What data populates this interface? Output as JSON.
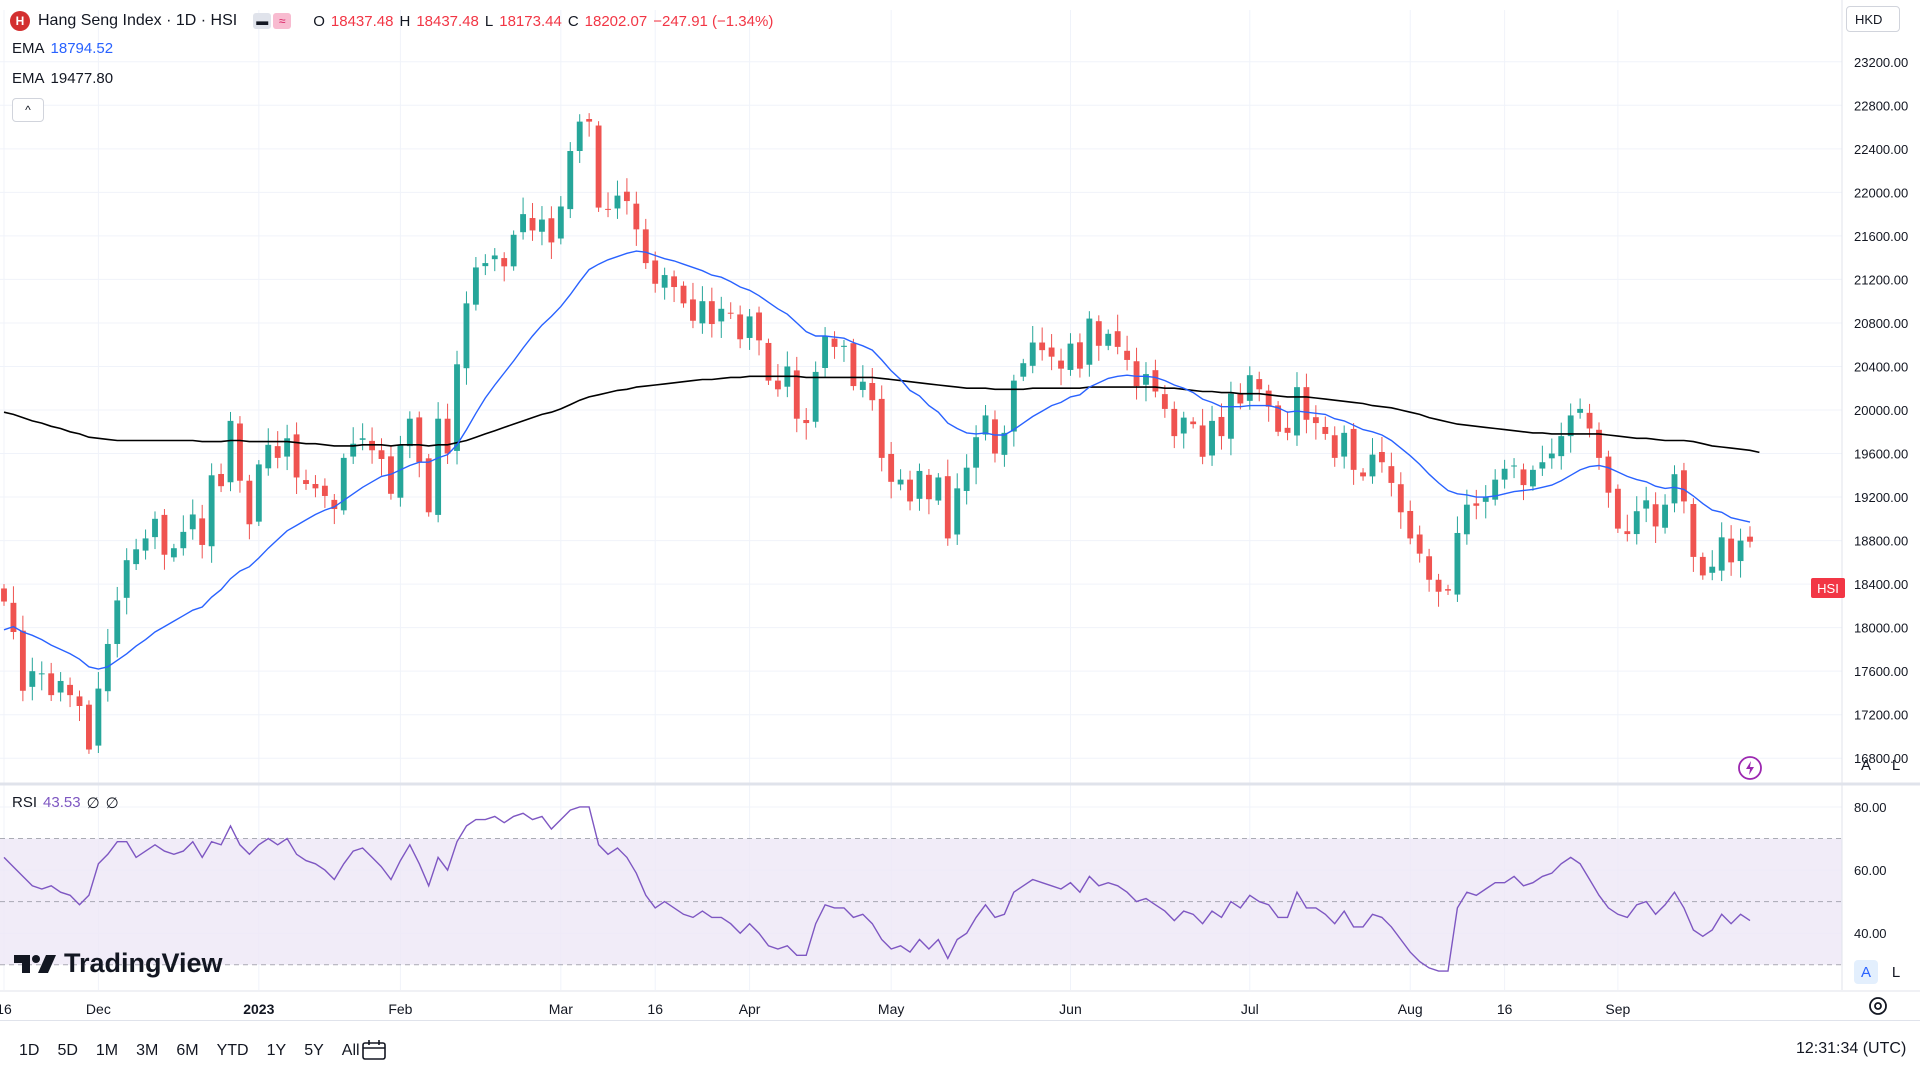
{
  "header": {
    "symbol_title": "Hang Seng Index · 1D · HSI",
    "logo_letter": "H",
    "compare_label": "≈",
    "o_label": "O",
    "o_value": "18437.48",
    "h_label": "H",
    "h_value": "18437.48",
    "l_label": "L",
    "l_value": "18173.44",
    "c_label": "C",
    "c_value": "18202.07",
    "change": "−247.91 (−1.34%)"
  },
  "indicators": {
    "ema1_label": "EMA",
    "ema1_value": "18794.52",
    "ema1_color": "#2962ff",
    "ema2_label": "EMA",
    "ema2_value": "19477.80",
    "ema2_color": "#000000",
    "collapse_icon": "^"
  },
  "currency": "HKD",
  "price_tag": "HSI",
  "rsi": {
    "label": "RSI",
    "value": "43.53",
    "extra1": "∅",
    "extra2": "∅",
    "color": "#7e57c2"
  },
  "buttons": {
    "auto": "A",
    "log": "L"
  },
  "brand": "TradingView",
  "timeframes": [
    "1D",
    "5D",
    "1M",
    "3M",
    "6M",
    "YTD",
    "1Y",
    "5Y",
    "All"
  ],
  "clock": "12:31:34 (UTC)",
  "colors": {
    "up": "#26a69a",
    "down": "#ef5350",
    "ema_fast": "#2962ff",
    "ema_slow": "#000000",
    "rsi": "#7e57c2",
    "rsi_band": "#ede7f6"
  },
  "chart_data": [
    {
      "type": "candlestick",
      "title": "Hang Seng Index · 1D · HSI",
      "y_ticks": [
        16800,
        17200,
        17600,
        18000,
        18400,
        18800,
        19200,
        19600,
        20000,
        20400,
        20800,
        21200,
        21600,
        22000,
        22400,
        22800,
        23200
      ],
      "y_tick_labels": [
        "16800.00",
        "17200.00",
        "17600.00",
        "18000.00",
        "18400.00",
        "18800.00",
        "19200.00",
        "19600.00",
        "20000.00",
        "20400.00",
        "20800.00",
        "21200.00",
        "21600.00",
        "22000.00",
        "22400.00",
        "22800.00",
        "23200.00"
      ],
      "x_tick_labels": [
        "16",
        "Dec",
        "2023",
        "Feb",
        "Mar",
        "16",
        "Apr",
        "May",
        "Jun",
        "Jul",
        "Aug",
        "16",
        "Sep"
      ],
      "x_tick_label_bars": [
        0,
        10,
        27,
        42,
        59,
        69,
        79,
        94,
        113,
        132,
        149,
        159,
        171
      ],
      "closes": [
        18240,
        17960,
        17420,
        17600,
        17580,
        17380,
        17510,
        17380,
        17280,
        16880,
        17440,
        17850,
        18250,
        18620,
        18720,
        18820,
        19000,
        18670,
        18730,
        18880,
        19040,
        18760,
        19400,
        19300,
        19900,
        19350,
        18950,
        19500,
        19680,
        19560,
        19740,
        19380,
        19320,
        19280,
        19210,
        19090,
        19560,
        19690,
        19740,
        19630,
        19550,
        19230,
        19680,
        19920,
        19520,
        19060,
        19920,
        19600,
        20420,
        20980,
        21310,
        21350,
        21420,
        21320,
        21610,
        21800,
        21650,
        21750,
        21540,
        21870,
        22380,
        22650,
        22650,
        21860,
        21840,
        21970,
        21920,
        21660,
        21350,
        21160,
        21240,
        21130,
        20980,
        20820,
        21000,
        20790,
        20930,
        20890,
        20650,
        20860,
        20640,
        20270,
        20190,
        20400,
        19920,
        19880,
        20350,
        20680,
        20580,
        20590,
        20220,
        20260,
        20090,
        19560,
        19340,
        19360,
        19160,
        19440,
        19180,
        19380,
        18820,
        19280,
        19470,
        19750,
        19950,
        19600,
        19790,
        20270,
        20430,
        20620,
        20550,
        20490,
        20380,
        20610,
        20380,
        20840,
        20590,
        20700,
        20580,
        20460,
        20220,
        20330,
        20170,
        20010,
        19760,
        19930,
        19870,
        19570,
        19900,
        19760,
        20150,
        20060,
        20320,
        20190,
        20030,
        19800,
        19790,
        20210,
        19910,
        19880,
        19780,
        19560,
        19790,
        19450,
        19390,
        19590,
        19520,
        19330,
        19060,
        18820,
        18680,
        18440,
        18330,
        18340,
        18870,
        19130,
        19120,
        19200,
        19360,
        19460,
        19490,
        19310,
        19450,
        19520,
        19600,
        19760,
        19950,
        20010,
        19830,
        19560,
        19240,
        18910,
        18860,
        19070,
        19170,
        18930,
        19130,
        19410,
        19160,
        18650,
        18480,
        18560,
        18830,
        18600,
        18800,
        18790
      ],
      "ema_fast": [
        17980,
        18010,
        17960,
        17930,
        17890,
        17840,
        17800,
        17760,
        17710,
        17640,
        17620,
        17640,
        17700,
        17760,
        17830,
        17890,
        17960,
        18010,
        18060,
        18110,
        18160,
        18190,
        18280,
        18350,
        18450,
        18520,
        18560,
        18640,
        18730,
        18810,
        18890,
        18940,
        18990,
        19040,
        19080,
        19110,
        19170,
        19230,
        19290,
        19340,
        19390,
        19410,
        19450,
        19490,
        19520,
        19520,
        19560,
        19590,
        19680,
        19820,
        19970,
        20110,
        20230,
        20340,
        20450,
        20570,
        20680,
        20780,
        20860,
        20950,
        21060,
        21180,
        21290,
        21340,
        21380,
        21410,
        21440,
        21460,
        21450,
        21420,
        21390,
        21370,
        21340,
        21310,
        21280,
        21240,
        21220,
        21180,
        21130,
        21100,
        21050,
        20990,
        20930,
        20880,
        20800,
        20720,
        20680,
        20680,
        20670,
        20660,
        20620,
        20590,
        20550,
        20460,
        20360,
        20280,
        20180,
        20130,
        20040,
        19980,
        19880,
        19830,
        19790,
        19780,
        19790,
        19770,
        19770,
        19820,
        19880,
        19940,
        19990,
        20040,
        20070,
        20120,
        20140,
        20210,
        20250,
        20290,
        20310,
        20320,
        20310,
        20310,
        20300,
        20270,
        20230,
        20200,
        20160,
        20100,
        20070,
        20030,
        20030,
        20030,
        20040,
        20040,
        20040,
        20020,
        19980,
        19990,
        19980,
        19970,
        19960,
        19920,
        19900,
        19860,
        19820,
        19800,
        19770,
        19720,
        19650,
        19580,
        19500,
        19410,
        19330,
        19260,
        19230,
        19220,
        19200,
        19200,
        19210,
        19230,
        19250,
        19260,
        19270,
        19290,
        19310,
        19350,
        19400,
        19450,
        19480,
        19490,
        19470,
        19430,
        19390,
        19360,
        19340,
        19300,
        19280,
        19290,
        19270,
        19210,
        19140,
        19080,
        19060,
        19010,
        18990,
        18970
      ],
      "ema_slow": [
        19980,
        19960,
        19930,
        19900,
        19880,
        19850,
        19830,
        19800,
        19780,
        19750,
        19740,
        19730,
        19720,
        19720,
        19720,
        19720,
        19720,
        19720,
        19720,
        19720,
        19720,
        19710,
        19710,
        19710,
        19720,
        19720,
        19710,
        19710,
        19710,
        19710,
        19710,
        19700,
        19690,
        19690,
        19680,
        19670,
        19670,
        19670,
        19680,
        19680,
        19680,
        19670,
        19680,
        19680,
        19680,
        19670,
        19680,
        19680,
        19700,
        19720,
        19750,
        19780,
        19810,
        19840,
        19870,
        19900,
        19930,
        19960,
        19980,
        20010,
        20050,
        20090,
        20120,
        20140,
        20160,
        20180,
        20190,
        20210,
        20220,
        20230,
        20240,
        20250,
        20260,
        20270,
        20280,
        20280,
        20290,
        20300,
        20300,
        20310,
        20310,
        20310,
        20310,
        20310,
        20310,
        20300,
        20300,
        20300,
        20300,
        20300,
        20300,
        20300,
        20300,
        20290,
        20280,
        20270,
        20260,
        20250,
        20240,
        20230,
        20220,
        20210,
        20200,
        20200,
        20200,
        20190,
        20190,
        20190,
        20190,
        20200,
        20200,
        20200,
        20200,
        20200,
        20200,
        20210,
        20210,
        20210,
        20210,
        20210,
        20210,
        20210,
        20210,
        20200,
        20200,
        20190,
        20180,
        20170,
        20170,
        20160,
        20160,
        20150,
        20150,
        20150,
        20140,
        20130,
        20120,
        20120,
        20120,
        20110,
        20100,
        20090,
        20080,
        20070,
        20060,
        20040,
        20030,
        20020,
        20000,
        19980,
        19960,
        19930,
        19910,
        19890,
        19870,
        19860,
        19850,
        19840,
        19830,
        19820,
        19810,
        19800,
        19790,
        19790,
        19780,
        19780,
        19780,
        19780,
        19780,
        19780,
        19770,
        19760,
        19750,
        19740,
        19740,
        19730,
        19720,
        19720,
        19720,
        19710,
        19690,
        19670,
        19660,
        19650,
        19640,
        19630,
        19610
      ]
    },
    {
      "type": "line",
      "title": "RSI",
      "y_ticks": [
        40,
        60,
        80
      ],
      "y_tick_labels": [
        "40.00",
        "60.00",
        "80.00"
      ],
      "bands": {
        "upper": 70,
        "middle": 50,
        "lower": 30
      },
      "values": [
        64,
        61,
        58,
        55,
        54,
        55,
        53,
        52,
        49,
        52,
        62,
        65,
        69,
        69,
        64,
        66,
        68,
        66,
        65,
        66,
        69,
        64,
        69,
        68,
        74,
        68,
        65,
        68,
        70,
        68,
        70,
        65,
        63,
        62,
        60,
        57,
        62,
        66,
        67,
        64,
        61,
        57,
        63,
        68,
        62,
        55,
        64,
        60,
        69,
        74,
        76,
        76,
        77,
        75,
        77,
        78,
        76,
        77,
        73,
        76,
        79,
        80,
        80,
        68,
        65,
        67,
        64,
        59,
        52,
        48,
        50,
        48,
        46,
        45,
        47,
        45,
        45,
        43,
        40,
        43,
        40,
        36,
        35,
        36,
        33,
        33,
        43,
        49,
        48,
        48,
        45,
        46,
        43,
        38,
        35,
        36,
        34,
        38,
        35,
        38,
        32,
        38,
        40,
        45,
        49,
        45,
        46,
        53,
        55,
        57,
        56,
        55,
        54,
        56,
        53,
        58,
        55,
        56,
        55,
        53,
        50,
        51,
        49,
        47,
        44,
        47,
        46,
        43,
        47,
        45,
        50,
        48,
        52,
        50,
        49,
        45,
        45,
        53,
        48,
        48,
        46,
        43,
        47,
        42,
        42,
        46,
        45,
        42,
        38,
        34,
        31,
        29,
        28,
        28,
        48,
        53,
        52,
        54,
        56,
        56,
        58,
        55,
        56,
        58,
        59,
        62,
        64,
        62,
        57,
        52,
        48,
        46,
        45,
        49,
        50,
        46,
        49,
        53,
        48,
        41,
        39,
        41,
        46,
        43,
        46,
        44
      ]
    }
  ]
}
